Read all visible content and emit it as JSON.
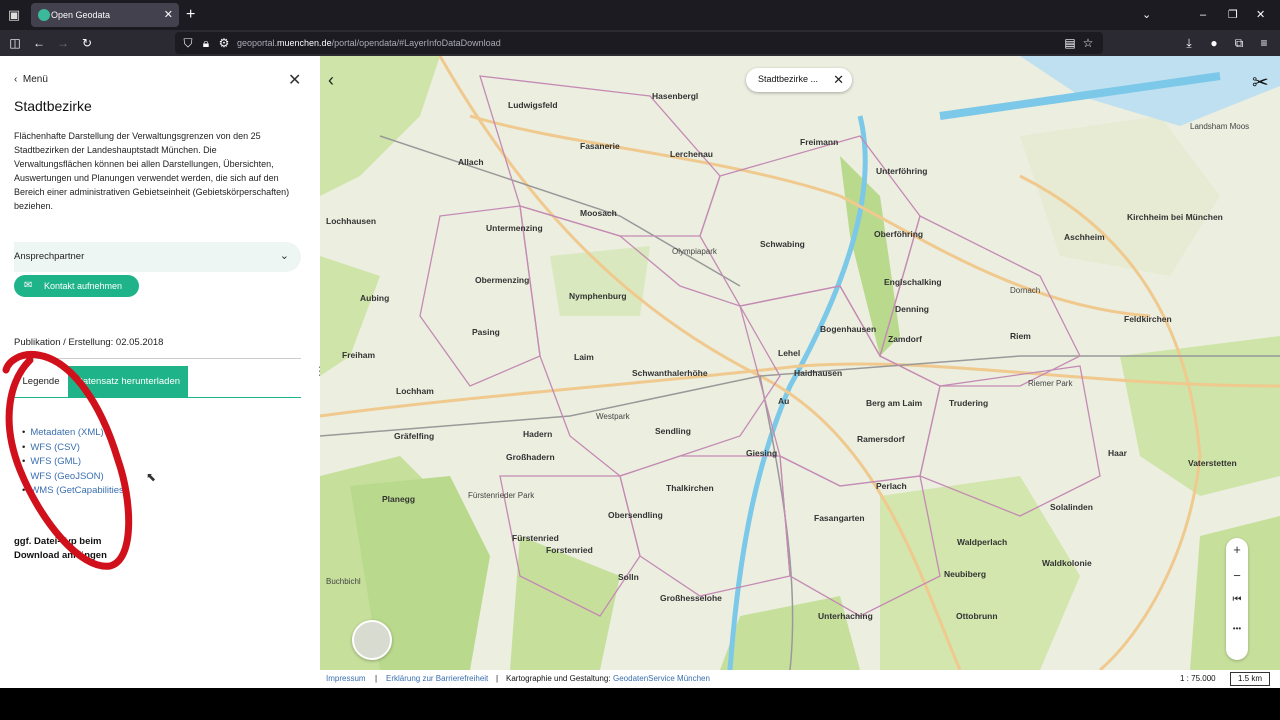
{
  "browser": {
    "tab_title": "Open Geodata",
    "tab_close": "✕",
    "new_tab": "+",
    "url_prefix": "geoportal.",
    "url_host": "muenchen.de",
    "url_path": "/portal/opendata/#LayerInfoDataDownload"
  },
  "sidebar": {
    "back_label": "Menü",
    "title": "Stadtbezirke",
    "description": "Flächenhafte Darstellung der Verwaltungsgrenzen von den 25 Stadtbezirken der Landeshauptstadt München. Die Verwaltungsflächen können bei allen Darstellungen, Übersichten, Auswertungen und Planungen verwendet werden, die sich auf den Bereich einer administrativen Gebietseinheit (Gebietskörperschaften) beziehen.",
    "accordion_label": "Ansprechpartner",
    "contact_button": "Kontakt aufnehmen",
    "publication": "Publikation / Erstellung: 02.05.2018",
    "tab_legend": "Legende",
    "tab_download": "Datensatz herunterladen",
    "downloads": [
      "Metadaten (XML)",
      "WFS (CSV)",
      "WFS (GML)",
      "WFS (GeoJSON)",
      "WMS (GetCapabilities)"
    ],
    "note": "ggf. Datei-Typ beim Download anhängen"
  },
  "map": {
    "layer_chip": "Stadtbezirke ...",
    "places": [
      {
        "name": "Hasenbergl",
        "bold": true
      },
      {
        "name": "Ludwigsfeld",
        "bold": true
      },
      {
        "name": "Fasanerie",
        "bold": true
      },
      {
        "name": "Lerchenau",
        "bold": true
      },
      {
        "name": "Freimann",
        "bold": true
      },
      {
        "name": "Allach",
        "bold": true
      },
      {
        "name": "Unterföhring",
        "bold": true
      },
      {
        "name": "Lochhausen",
        "bold": true
      },
      {
        "name": "Moosach",
        "bold": true
      },
      {
        "name": "Untermenzing",
        "bold": true
      },
      {
        "name": "Schwabing",
        "bold": true
      },
      {
        "name": "Oberföhring",
        "bold": true
      },
      {
        "name": "Aschheim",
        "bold": true
      },
      {
        "name": "Kirchheim bei München",
        "bold": true
      },
      {
        "name": "Obermenzing",
        "bold": true
      },
      {
        "name": "Englschalking",
        "bold": true
      },
      {
        "name": "Aubing",
        "bold": true
      },
      {
        "name": "Nymphenburg",
        "bold": true
      },
      {
        "name": "Denning",
        "bold": true
      },
      {
        "name": "Feldkirchen",
        "bold": true
      },
      {
        "name": "Pasing",
        "bold": true
      },
      {
        "name": "Bogenhausen",
        "bold": true
      },
      {
        "name": "Zamdorf",
        "bold": true
      },
      {
        "name": "Riem",
        "bold": true
      },
      {
        "name": "Freiham",
        "bold": true
      },
      {
        "name": "Laim",
        "bold": true
      },
      {
        "name": "Lehel",
        "bold": true
      },
      {
        "name": "Schwanthalerhöhe",
        "bold": true
      },
      {
        "name": "Haidhausen",
        "bold": true
      },
      {
        "name": "Lochham",
        "bold": true
      },
      {
        "name": "Au",
        "bold": true
      },
      {
        "name": "Berg am Laim",
        "bold": true
      },
      {
        "name": "Trudering",
        "bold": true
      },
      {
        "name": "Gräfelfing",
        "bold": true
      },
      {
        "name": "Hadern",
        "bold": true
      },
      {
        "name": "Sendling",
        "bold": true
      },
      {
        "name": "Ramersdorf",
        "bold": true
      },
      {
        "name": "Haar",
        "bold": true
      },
      {
        "name": "Großhadern",
        "bold": true
      },
      {
        "name": "Giesing",
        "bold": true
      },
      {
        "name": "Vaterstetten",
        "bold": true
      },
      {
        "name": "Thalkirchen",
        "bold": true
      },
      {
        "name": "Perlach",
        "bold": true
      },
      {
        "name": "Planegg",
        "bold": true
      },
      {
        "name": "Obersendling",
        "bold": true
      },
      {
        "name": "Fasangarten",
        "bold": true
      },
      {
        "name": "Solalinden",
        "bold": true
      },
      {
        "name": "Fürstenried",
        "bold": true
      },
      {
        "name": "Waldperlach",
        "bold": true
      },
      {
        "name": "Forstenried",
        "bold": true
      },
      {
        "name": "Neubiberg",
        "bold": true
      },
      {
        "name": "Waldkolonie",
        "bold": true
      },
      {
        "name": "Solln",
        "bold": true
      },
      {
        "name": "Großhesselohe",
        "bold": true
      },
      {
        "name": "Unterhaching",
        "bold": true
      },
      {
        "name": "Ottobrunn",
        "bold": true
      },
      {
        "name": "Landsham Moos",
        "bold": false
      },
      {
        "name": "Dornach",
        "bold": false
      },
      {
        "name": "Riemer Park",
        "bold": false
      },
      {
        "name": "Westpark",
        "bold": false
      },
      {
        "name": "Olympiapark",
        "bold": false
      },
      {
        "name": "Fürstenrieder Park",
        "bold": false
      },
      {
        "name": "Buchbichl",
        "bold": false
      }
    ],
    "zoom_in": "+",
    "zoom_out": "−",
    "more": "•••"
  },
  "footer": {
    "impressum": "Impressum",
    "accessibility": "Erklärung zur Barrierefreiheit",
    "carto_label": "Kartographie und Gestaltung:",
    "carto_value": "GeodatenService München",
    "scale": "1 : 75.000",
    "scalebar": "1.5 km"
  },
  "colors": {
    "accent": "#1fb38a",
    "link": "#3a6fb0",
    "annotation": "#d0101a"
  }
}
